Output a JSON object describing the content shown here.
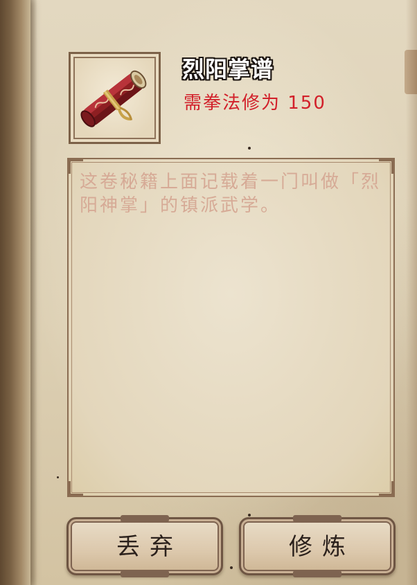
{
  "item": {
    "name": "烈阳掌谱",
    "requirement": "需拳法修为 150",
    "icon": "scroll-icon"
  },
  "description": {
    "text": "这卷秘籍上面记载着一门叫做「烈阳神掌」的镇派武学。"
  },
  "buttons": {
    "discard_label": "丢弃",
    "practice_label": "修炼"
  },
  "colors": {
    "requirement": "#d2202a",
    "description": "#d6aa96",
    "frame": "#8a6c52"
  }
}
